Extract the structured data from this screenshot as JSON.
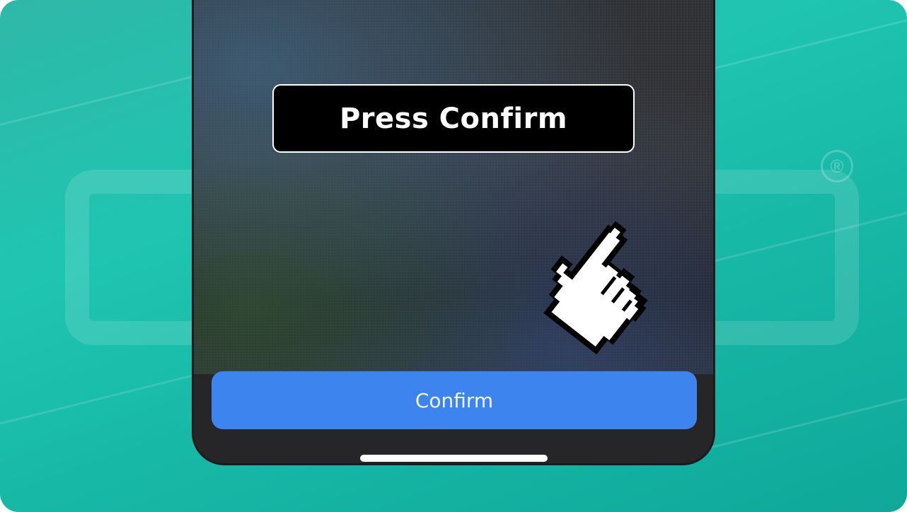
{
  "overlay": {
    "instruction": "Press Confirm"
  },
  "phone": {
    "confirm_label": "Confirm"
  },
  "watermark": {
    "mark": "®"
  },
  "icons": {
    "cursor": "hand-pointer-icon"
  },
  "colors": {
    "accent": "#3d84ef",
    "background": "#1fc5b1",
    "phone_body": "#262629"
  }
}
